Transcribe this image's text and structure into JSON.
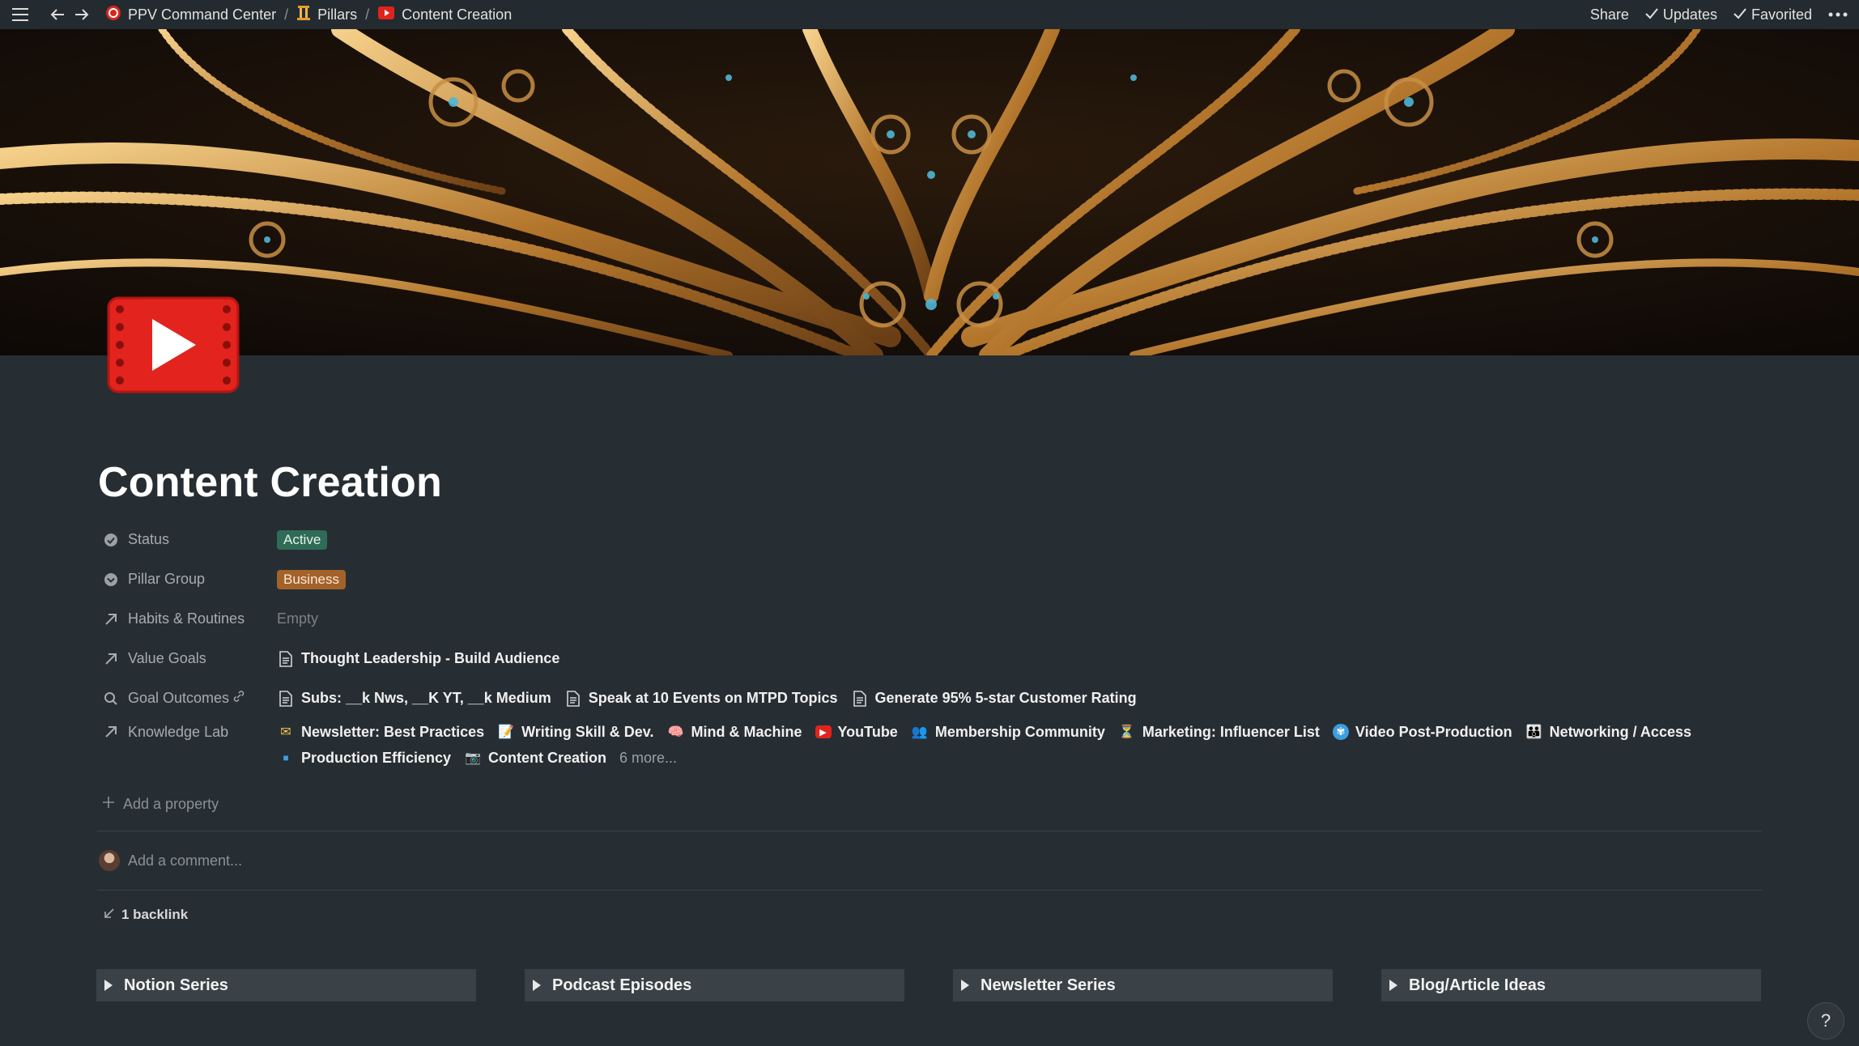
{
  "topbar": {
    "breadcrumbs": [
      {
        "label": "PPV Command Center",
        "icon": "ppv-logo-icon"
      },
      {
        "label": "Pillars",
        "icon": "pillar-icon"
      },
      {
        "label": "Content Creation",
        "icon": "youtube-icon"
      }
    ],
    "separator": "/",
    "actions": {
      "share": "Share",
      "updates": "Updates",
      "favorited": "Favorited"
    }
  },
  "page": {
    "title": "Content Creation",
    "icon": "film-play-icon"
  },
  "properties": {
    "status": {
      "label": "Status",
      "value": "Active",
      "color": "#2f6b57"
    },
    "pillar_group": {
      "label": "Pillar Group",
      "value": "Business",
      "color": "#a3622a"
    },
    "habits": {
      "label": "Habits & Routines",
      "value": "Empty"
    },
    "value_goals": {
      "label": "Value Goals",
      "items": [
        "Thought Leadership - Build Audience"
      ]
    },
    "goal_outcomes": {
      "label": "Goal Outcomes",
      "items": [
        "Subs: __k Nws, __K YT, __k Medium",
        "Speak at 10 Events on MTPD Topics",
        "Generate 95% 5-star Customer Rating"
      ]
    },
    "knowledge_lab": {
      "label": "Knowledge Lab",
      "items": [
        {
          "label": "Newsletter: Best Practices",
          "icon": "envelope-icon",
          "glyph": "✉"
        },
        {
          "label": "Writing Skill & Dev.",
          "icon": "memo-icon",
          "glyph": "📝"
        },
        {
          "label": "Mind & Machine",
          "icon": "brain-icon",
          "glyph": "🧠"
        },
        {
          "label": "YouTube",
          "icon": "youtube-icon",
          "glyph": "▶"
        },
        {
          "label": "Membership Community",
          "icon": "community-icon",
          "glyph": "👥"
        },
        {
          "label": "Marketing: Influencer List",
          "icon": "hourglass-icon",
          "glyph": "⏳"
        },
        {
          "label": "Video Post-Production",
          "icon": "film-reel-icon",
          "glyph": "✾"
        },
        {
          "label": "Networking / Access",
          "icon": "people-icon",
          "glyph": "👪"
        },
        {
          "label": "Production Efficiency",
          "icon": "blue-square-icon",
          "glyph": "■"
        },
        {
          "label": "Content Creation",
          "icon": "camera-icon",
          "glyph": "📷"
        }
      ],
      "more": "6 more..."
    },
    "add_property": "Add a property"
  },
  "comment": {
    "placeholder": "Add a comment..."
  },
  "backlink": "1 backlink",
  "toggles": [
    "Notion Series",
    "Podcast Episodes",
    "Newsletter Series",
    "Blog/Article Ideas"
  ],
  "help": "?"
}
